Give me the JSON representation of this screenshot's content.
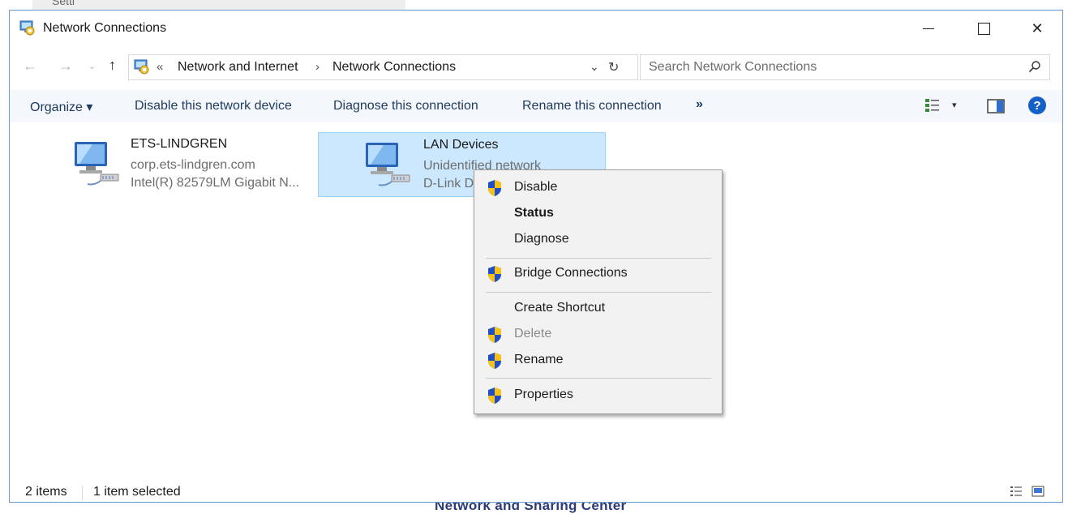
{
  "background": {
    "top_window_fragment": "Setti",
    "bottom_fragment": "Network and Sharing Center"
  },
  "window": {
    "title": "Network Connections",
    "controls": {
      "minimize": "minimize",
      "maximize": "maximize",
      "close": "✕"
    }
  },
  "nav": {
    "back": "←",
    "forward": "→",
    "recent": "⌄",
    "up": "↑",
    "address": {
      "separator": "«",
      "segments": [
        "Network and Internet",
        "Network Connections"
      ],
      "chevron": "›",
      "dropdown": "⌄",
      "refresh": "↻"
    },
    "search": {
      "placeholder": "Search Network Connections"
    }
  },
  "commands": {
    "organize": "Organize ▾",
    "disable": "Disable this network device",
    "diagnose": "Diagnose this connection",
    "rename": "Rename this connection",
    "more": "»",
    "help": "?",
    "views_drop": "▾"
  },
  "connections": [
    {
      "name": "ETS-LINDGREN",
      "network": "corp.ets-lindgren.com",
      "device": "Intel(R) 82579LM Gigabit N...",
      "selected": false
    },
    {
      "name": "LAN Devices",
      "network": "Unidentified network",
      "device": "D-Link D",
      "selected": true
    }
  ],
  "context_menu": {
    "items": [
      {
        "label": "Disable",
        "shield": true,
        "bold": false,
        "disabled": false
      },
      {
        "label": "Status",
        "shield": false,
        "bold": true,
        "disabled": false
      },
      {
        "label": "Diagnose",
        "shield": false,
        "bold": false,
        "disabled": false
      },
      {
        "label": "Bridge Connections",
        "shield": true,
        "bold": false,
        "disabled": false
      },
      {
        "label": "Create Shortcut",
        "shield": false,
        "bold": false,
        "disabled": false
      },
      {
        "label": "Delete",
        "shield": true,
        "bold": false,
        "disabled": true
      },
      {
        "label": "Rename",
        "shield": true,
        "bold": false,
        "disabled": false
      },
      {
        "label": "Properties",
        "shield": true,
        "bold": false,
        "disabled": false
      }
    ]
  },
  "status": {
    "items_count": "2 items",
    "selected_count": "1 item selected"
  },
  "colors": {
    "accent_blue": "#1560c7",
    "selection_fill": "#cce8ff",
    "selection_border": "#99d1ff",
    "command_text": "#1e3a5f",
    "shield_blue": "#1f4fc2",
    "shield_yellow": "#f6c21a"
  },
  "icons": {
    "app": "network-connections-icon",
    "connection": "network-adapter-icon",
    "shield": "uac-shield-icon"
  }
}
